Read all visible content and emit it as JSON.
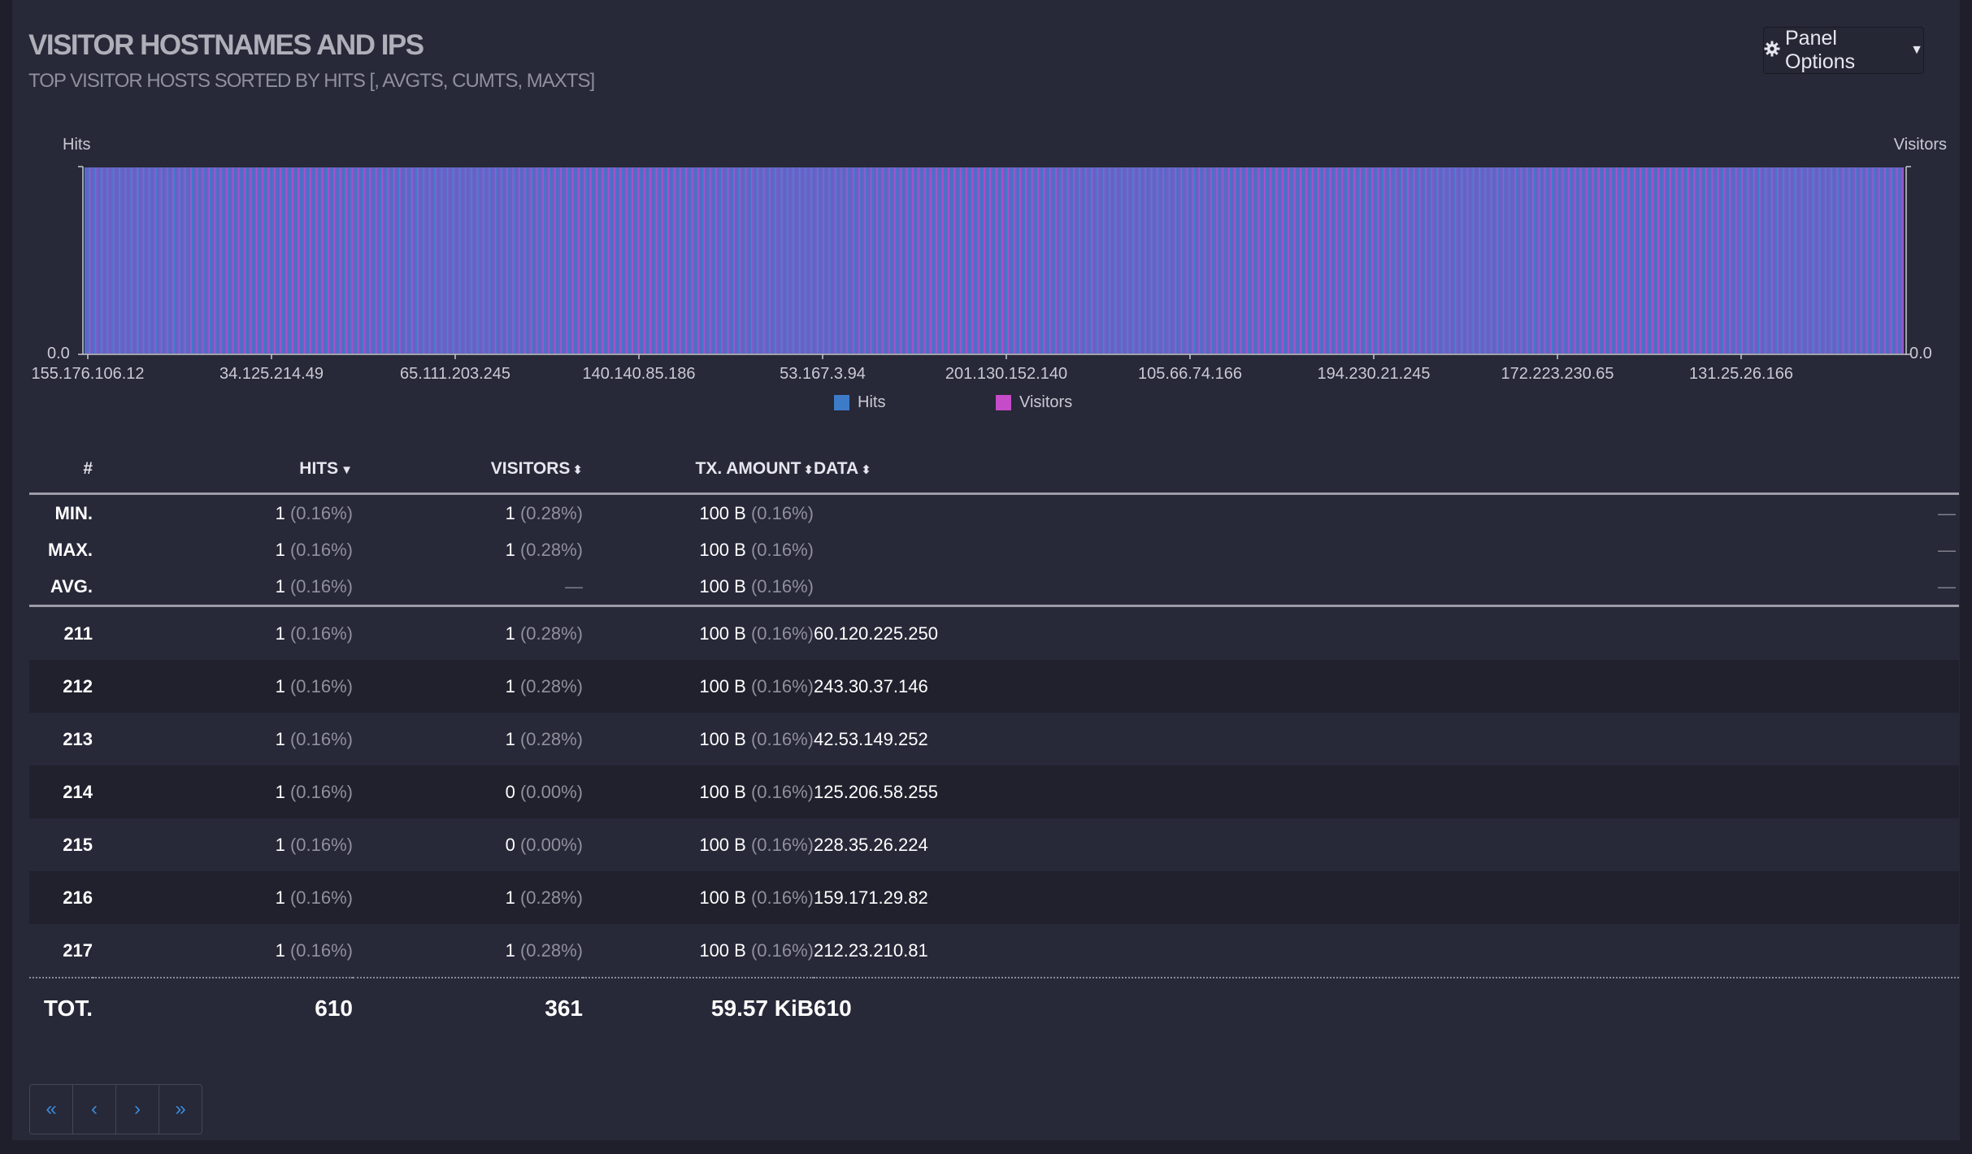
{
  "panel": {
    "title": "VISITOR HOSTNAMES AND IPS",
    "subtitle": "TOP VISITOR HOSTS SORTED BY HITS [, AVGTS, CUMTS, MAXTS]",
    "options_label": "Panel Options"
  },
  "icons": {
    "options": "gear-icon",
    "options_caret": "caret-down-icon",
    "pager": [
      "double-chevron-left-icon",
      "chevron-left-icon",
      "chevron-right-icon",
      "double-chevron-right-icon"
    ]
  },
  "colors": {
    "hits": "#3d7bc9",
    "visitors": "#c54bc8",
    "link": "#3b8bd9"
  },
  "chart_data": {
    "type": "bar",
    "ylabel_left": "Hits",
    "ylabel_right": "Visitors",
    "left_tick": "0.0",
    "right_tick": "0.0",
    "x_tick_labels": [
      "155.176.106.12",
      "34.125.214.49",
      "65.111.203.245",
      "140.140.85.186",
      "53.167.3.94",
      "201.130.152.140",
      "105.66.74.166",
      "194.230.21.245",
      "172.223.230.65",
      "131.25.26.166"
    ],
    "series": [
      {
        "name": "Hits",
        "color": "#3d7bc9"
      },
      {
        "name": "Visitors",
        "color": "#c54bc8"
      }
    ],
    "category_count": 610,
    "legend_position": "bottom-center"
  },
  "table": {
    "headers": {
      "num": "#",
      "hits": "HITS",
      "visitors": "VISITORS",
      "tx": "TX. AMOUNT",
      "data": "DATA"
    },
    "stats": [
      {
        "label": "MIN.",
        "hits": "1",
        "hits_pct": "(0.16%)",
        "visitors": "1",
        "visitors_pct": "(0.28%)",
        "tx": "100 B",
        "tx_pct": "(0.16%)",
        "data": "—"
      },
      {
        "label": "MAX.",
        "hits": "1",
        "hits_pct": "(0.16%)",
        "visitors": "1",
        "visitors_pct": "(0.28%)",
        "tx": "100 B",
        "tx_pct": "(0.16%)",
        "data": "—"
      },
      {
        "label": "AVG.",
        "hits": "1",
        "hits_pct": "(0.16%)",
        "visitors": "—",
        "visitors_pct": "",
        "tx": "100 B",
        "tx_pct": "(0.16%)",
        "data": "—"
      }
    ],
    "rows": [
      {
        "num": "211",
        "hits": "1",
        "hits_pct": "(0.16%)",
        "visitors": "1",
        "visitors_pct": "(0.28%)",
        "tx": "100 B",
        "tx_pct": "(0.16%)",
        "data": "60.120.225.250"
      },
      {
        "num": "212",
        "hits": "1",
        "hits_pct": "(0.16%)",
        "visitors": "1",
        "visitors_pct": "(0.28%)",
        "tx": "100 B",
        "tx_pct": "(0.16%)",
        "data": "243.30.37.146"
      },
      {
        "num": "213",
        "hits": "1",
        "hits_pct": "(0.16%)",
        "visitors": "1",
        "visitors_pct": "(0.28%)",
        "tx": "100 B",
        "tx_pct": "(0.16%)",
        "data": "42.53.149.252"
      },
      {
        "num": "214",
        "hits": "1",
        "hits_pct": "(0.16%)",
        "visitors": "0",
        "visitors_pct": "(0.00%)",
        "tx": "100 B",
        "tx_pct": "(0.16%)",
        "data": "125.206.58.255"
      },
      {
        "num": "215",
        "hits": "1",
        "hits_pct": "(0.16%)",
        "visitors": "0",
        "visitors_pct": "(0.00%)",
        "tx": "100 B",
        "tx_pct": "(0.16%)",
        "data": "228.35.26.224"
      },
      {
        "num": "216",
        "hits": "1",
        "hits_pct": "(0.16%)",
        "visitors": "1",
        "visitors_pct": "(0.28%)",
        "tx": "100 B",
        "tx_pct": "(0.16%)",
        "data": "159.171.29.82"
      },
      {
        "num": "217",
        "hits": "1",
        "hits_pct": "(0.16%)",
        "visitors": "1",
        "visitors_pct": "(0.28%)",
        "tx": "100 B",
        "tx_pct": "(0.16%)",
        "data": "212.23.210.81"
      }
    ],
    "total": {
      "label": "TOT.",
      "hits": "610",
      "visitors": "361",
      "tx": "59.57 KiB",
      "data": "610"
    }
  },
  "pager": {
    "first": "«",
    "prev": "‹",
    "next": "›",
    "last": "»"
  }
}
